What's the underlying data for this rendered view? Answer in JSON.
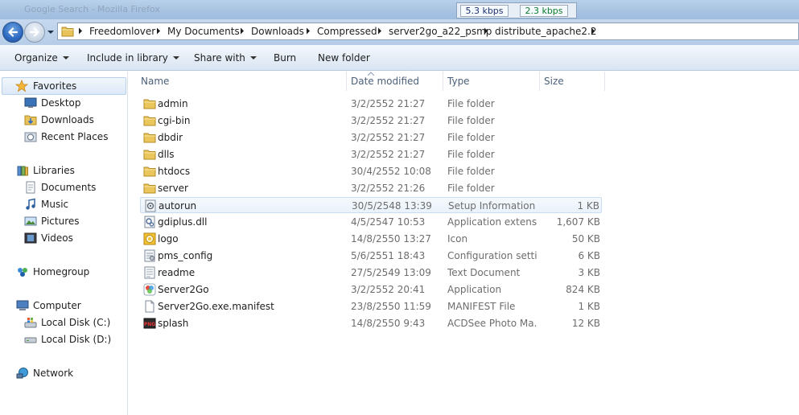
{
  "window": {
    "title": "Google Search - Mozilla Firefox"
  },
  "network_meter": {
    "download": "5.3 kbps",
    "upload": "2.3 kbps"
  },
  "address": {
    "breadcrumbs": [
      "Freedomlover",
      "My Documents",
      "Downloads",
      "Compressed",
      "server2go_a22_psmp",
      "distribute_apache2.2"
    ]
  },
  "toolbar": {
    "organize": "Organize",
    "include_in_library": "Include in library",
    "share_with": "Share with",
    "burn": "Burn",
    "new_folder": "New folder"
  },
  "nav": {
    "favorites": {
      "label": "Favorites",
      "items": [
        "Desktop",
        "Downloads",
        "Recent Places"
      ]
    },
    "libraries": {
      "label": "Libraries",
      "items": [
        "Documents",
        "Music",
        "Pictures",
        "Videos"
      ]
    },
    "homegroup": "Homegroup",
    "computer": {
      "label": "Computer",
      "items": [
        "Local Disk (C:)",
        "Local Disk (D:)"
      ]
    },
    "network": "Network"
  },
  "columns": {
    "name": "Name",
    "date_modified": "Date modified",
    "type": "Type",
    "size": "Size"
  },
  "files": [
    {
      "name": "admin",
      "date": "3/2/2552 21:27",
      "type": "File folder",
      "size": "",
      "icon": "folder-icon"
    },
    {
      "name": "cgi-bin",
      "date": "3/2/2552 21:27",
      "type": "File folder",
      "size": "",
      "icon": "folder-icon"
    },
    {
      "name": "dbdir",
      "date": "3/2/2552 21:27",
      "type": "File folder",
      "size": "",
      "icon": "folder-icon"
    },
    {
      "name": "dlls",
      "date": "3/2/2552 21:27",
      "type": "File folder",
      "size": "",
      "icon": "folder-icon"
    },
    {
      "name": "htdocs",
      "date": "30/4/2552 10:08",
      "type": "File folder",
      "size": "",
      "icon": "folder-icon"
    },
    {
      "name": "server",
      "date": "3/2/2552 21:26",
      "type": "File folder",
      "size": "",
      "icon": "folder-icon"
    },
    {
      "name": "autorun",
      "date": "30/5/2548 13:39",
      "type": "Setup Information",
      "size": "1 KB",
      "icon": "setup-info-icon"
    },
    {
      "name": "gdiplus.dll",
      "date": "4/5/2547 10:53",
      "type": "Application extensi...",
      "size": "1,607 KB",
      "icon": "dll-icon"
    },
    {
      "name": "logo",
      "date": "14/8/2550 13:27",
      "type": "Icon",
      "size": "50 KB",
      "icon": "icon-file-icon"
    },
    {
      "name": "pms_config",
      "date": "5/6/2551 18:43",
      "type": "Configuration setti...",
      "size": "6 KB",
      "icon": "config-icon"
    },
    {
      "name": "readme",
      "date": "27/5/2549 13:09",
      "type": "Text Document",
      "size": "3 KB",
      "icon": "text-doc-icon"
    },
    {
      "name": "Server2Go",
      "date": "3/2/2552 20:41",
      "type": "Application",
      "size": "824 KB",
      "icon": "application-icon"
    },
    {
      "name": "Server2Go.exe.manifest",
      "date": "23/8/2550 11:59",
      "type": "MANIFEST File",
      "size": "1 KB",
      "icon": "blank-file-icon"
    },
    {
      "name": "splash",
      "date": "14/8/2550 9:43",
      "type": "ACDSee Photo Ma...",
      "size": "12 KB",
      "icon": "png-icon"
    }
  ]
}
